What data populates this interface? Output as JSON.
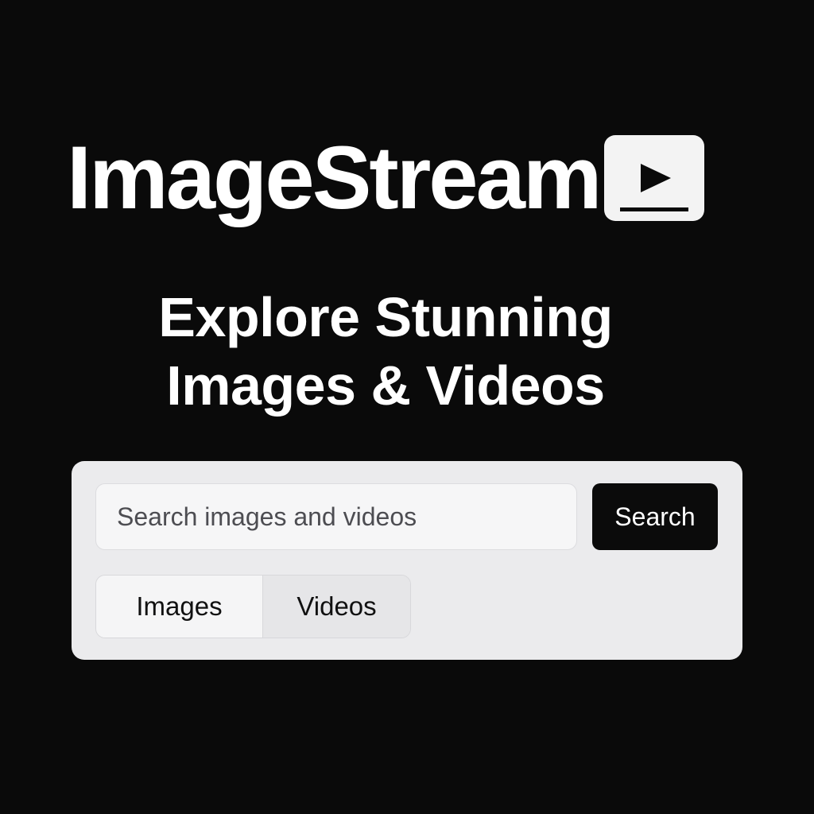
{
  "brand": {
    "name": "ImageStream",
    "logo_icon": "play-video-icon"
  },
  "hero": {
    "headline_line1": "Explore Stunning",
    "headline_line2": "Images & Videos"
  },
  "search": {
    "placeholder": "Search images and videos",
    "value": "",
    "button_label": "Search"
  },
  "filters": {
    "tabs": [
      {
        "label": "Images"
      },
      {
        "label": "Videos"
      }
    ]
  },
  "colors": {
    "background": "#0a0a0a",
    "panel": "#ebebed",
    "accent": "#0b0b0b",
    "text_primary": "#ffffff"
  }
}
